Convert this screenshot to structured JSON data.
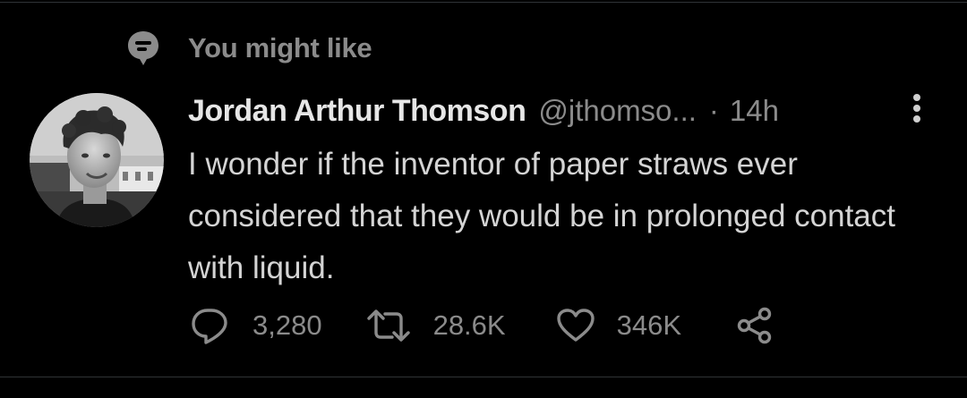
{
  "context": {
    "label": "You might like",
    "icon": "topic-bubble-icon"
  },
  "tweet": {
    "author_name": "Jordan Arthur Thomson",
    "author_handle": "@jthomso...",
    "separator": "·",
    "timestamp": "14h",
    "text": "I wonder if the inventor of paper straws ever considered that they would be in prolonged contact with liquid.",
    "avatar_description": "profile photo"
  },
  "actions": {
    "reply_count": "3,280",
    "retweet_count": "28.6K",
    "like_count": "346K"
  },
  "icons": {
    "reply": "reply-icon",
    "retweet": "retweet-icon",
    "like": "heart-icon",
    "share": "share-icon",
    "more": "more-vertical-icon"
  },
  "colors": {
    "background": "#000000",
    "muted_text": "#8b8b8b",
    "primary_text": "#e6e6e6",
    "divider": "#2f3336"
  }
}
